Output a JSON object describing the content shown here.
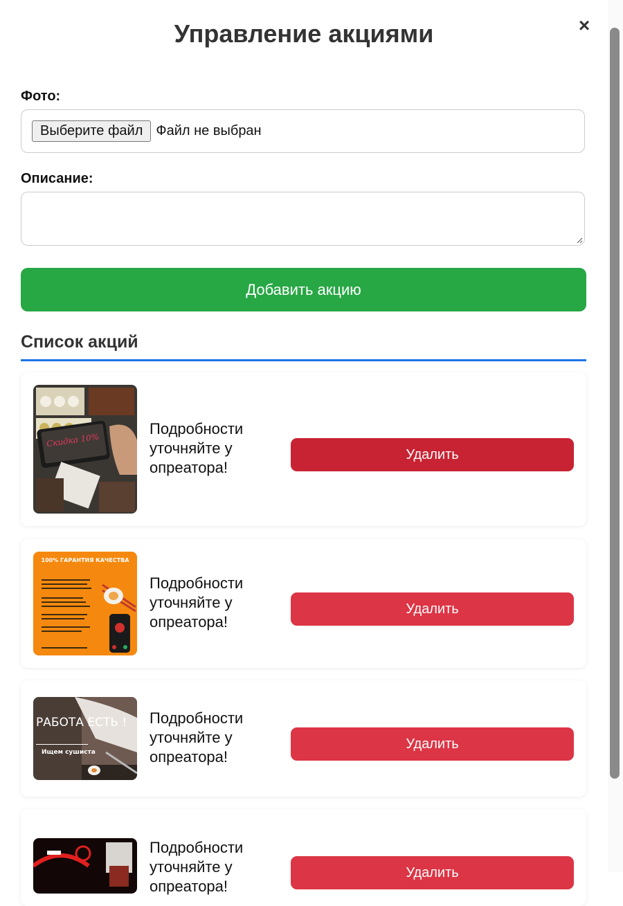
{
  "modal": {
    "title": "Управление акциями",
    "close_label": "×"
  },
  "form": {
    "photo_label": "Фото:",
    "file_button_label": "Выберите файл",
    "file_status": "Файл не выбран",
    "description_label": "Описание:",
    "description_value": "",
    "add_button_label": "Добавить акцию"
  },
  "promotions": {
    "section_title": "Список акций",
    "items": [
      {
        "description": "Подробности уточняйте у опреатора!",
        "delete_label": "Удалить",
        "image_text": "Скидка 10%",
        "delete_color": "#c82333"
      },
      {
        "description": "Подробности уточняйте у опреатора!",
        "delete_label": "Удалить",
        "image_text": "100% ГАРАНТИЯ КАЧЕСТВА",
        "delete_color": "#dc3545"
      },
      {
        "description": "Подробности уточняйте у опреатора!",
        "delete_label": "Удалить",
        "image_text": "РАБОТА ЕСТЬ !",
        "image_subtext": "Ищем сушиста",
        "delete_color": "#dc3545"
      },
      {
        "description": "Подробности уточняйте у опреатора!",
        "delete_label": "Удалить",
        "delete_color": "#dc3545"
      }
    ]
  },
  "colors": {
    "add_button": "#28a745",
    "delete_button": "#dc3545",
    "delete_button_hover": "#c82333",
    "section_underline": "#1a73e8"
  }
}
